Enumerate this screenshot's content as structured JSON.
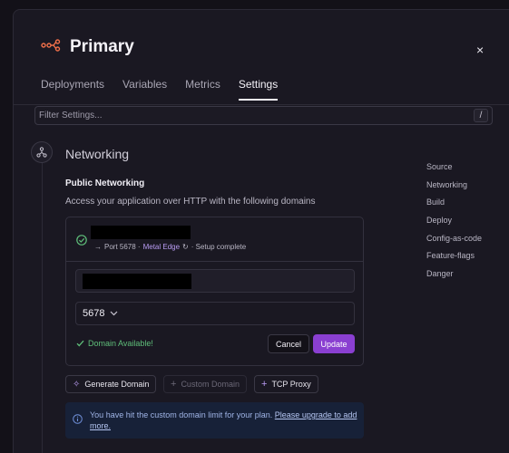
{
  "header": {
    "title": "Primary",
    "close_label": "×"
  },
  "tabs": [
    {
      "label": "Deployments"
    },
    {
      "label": "Variables"
    },
    {
      "label": "Metrics"
    },
    {
      "label": "Settings"
    }
  ],
  "filter": {
    "placeholder": "Filter Settings...",
    "shortcut": "/"
  },
  "section": {
    "title": "Networking",
    "subtitle": "Public Networking",
    "description": "Access your application over HTTP with the following domains"
  },
  "domain_card": {
    "meta_port": "Port 5678 ·",
    "meta_edge": "Metal Edge",
    "meta_status": "· Setup complete",
    "port_value": "5678",
    "availability": "Domain Available!",
    "cancel_label": "Cancel",
    "update_label": "Update"
  },
  "actions": {
    "generate": "Generate Domain",
    "custom": "Custom Domain",
    "tcp": "TCP Proxy"
  },
  "notice": {
    "text": "You have hit the custom domain limit for your plan.",
    "link": "Please upgrade to add more."
  },
  "side_nav": [
    {
      "label": "Source"
    },
    {
      "label": "Networking"
    },
    {
      "label": "Build"
    },
    {
      "label": "Deploy"
    },
    {
      "label": "Config-as-code"
    },
    {
      "label": "Feature-flags"
    },
    {
      "label": "Danger"
    }
  ],
  "colors": {
    "accent": "#8a3fd1",
    "success": "#5fbf7a",
    "service_icon": "#f0704a",
    "info_bg": "#172138"
  }
}
